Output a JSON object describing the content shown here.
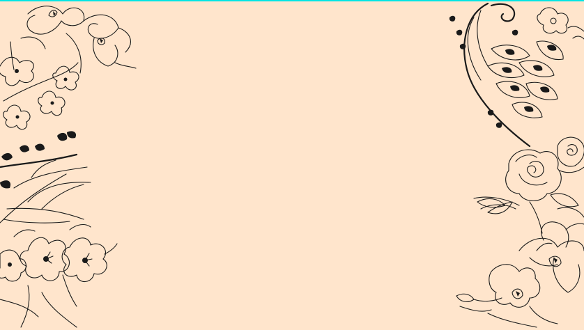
{
  "colors": {
    "background": "#FFE5CC",
    "accent_bar": "#00E5E5",
    "ink": "#1a1a1a"
  },
  "decorations": {
    "left": [
      "orchid-icon",
      "blossom-icon",
      "leaf-sprig-icon",
      "hibiscus-icon"
    ],
    "right": [
      "peacock-feather-icon",
      "rose-icon",
      "lily-icon"
    ]
  }
}
